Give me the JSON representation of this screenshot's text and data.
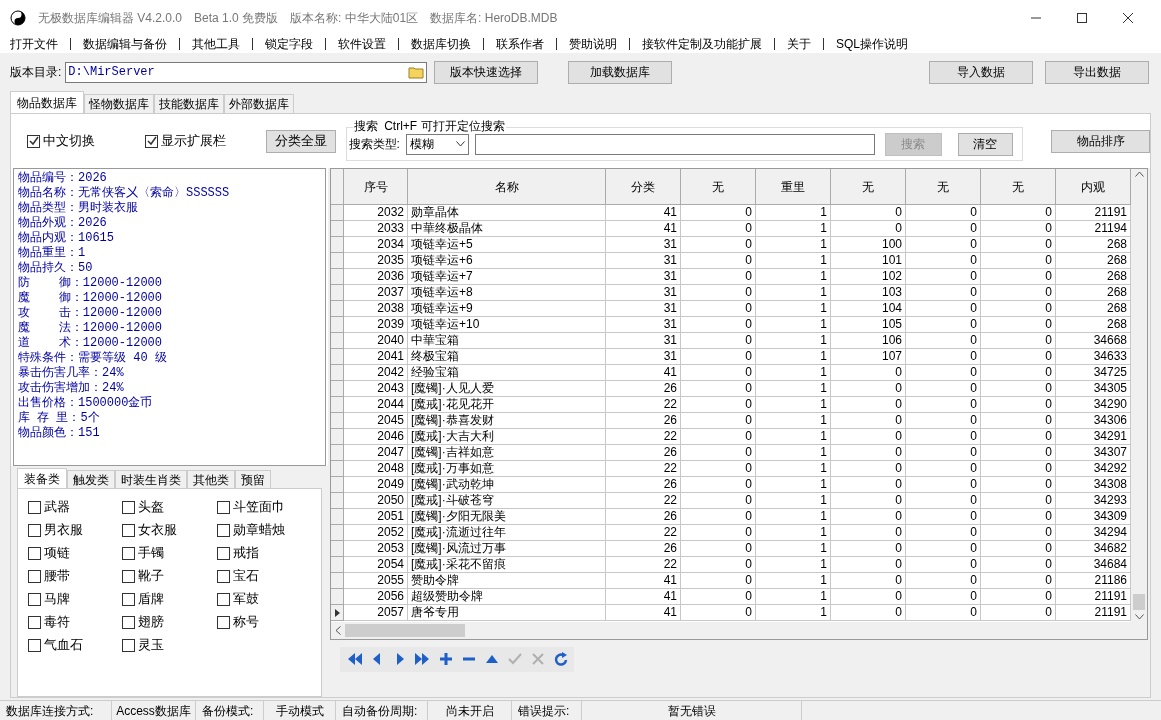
{
  "window": {
    "title": "无极数据库编辑器 V4.2.0.0",
    "edition": "Beta 1.0 免费版",
    "version_name": "版本名称: 中华大陆01区",
    "db_name": "数据库名: HeroDB.MDB"
  },
  "menu": [
    "打开文件",
    "数据编辑与备份",
    "其他工具",
    "锁定字段",
    "软件设置",
    "数据库切换",
    "联系作者",
    "赞助说明",
    "接软件定制及功能扩展",
    "关于",
    "SQL操作说明"
  ],
  "toolbar": {
    "dir_label": "版本目录:",
    "dir_value": "D:\\MirServer",
    "buttons": [
      "版本快速选择",
      "加载数据库"
    ],
    "right_buttons": [
      "导入数据",
      "导出数据"
    ]
  },
  "tabs": [
    {
      "label": "物品数据库",
      "selected": true
    },
    {
      "label": "怪物数据库",
      "selected": false
    },
    {
      "label": "技能数据库",
      "selected": false
    },
    {
      "label": "外部数据库",
      "selected": false
    }
  ],
  "options": [
    {
      "label": "中文切换",
      "checked": true
    },
    {
      "label": "显示扩展栏",
      "checked": true
    }
  ],
  "show_all_button": "分类全显",
  "search": {
    "legend": "搜索  Ctrl+F 可打开定位搜索",
    "type_label": "搜索类型:",
    "type_value": "模糊",
    "search_button": "搜索",
    "search_disabled": true,
    "clear_button": "清空"
  },
  "sort_button": "物品排序",
  "info": [
    "物品编号：2026",
    "物品名称：无常侠客㐅〈索命〉SSSSSS",
    "物品类型：男时装衣服",
    "物品外观：2026",
    "物品内观：10615",
    "物品重里：1",
    "物品持久：50",
    "防    御：12000-12000",
    "魔    御：12000-12000",
    "攻    击：12000-12000",
    "魔    法：12000-12000",
    "道    术：12000-12000",
    "特殊条件：需要等级 40 级",
    "暴击伤害几率：24%",
    "攻击伤害增加：24%",
    "出售价格：1500000金币",
    "库 存 里：5个",
    "物品颜色：151"
  ],
  "category_tabs": [
    {
      "label": "装备类",
      "selected": true
    },
    {
      "label": "触发类",
      "selected": false
    },
    {
      "label": "时装生肖类",
      "selected": false
    },
    {
      "label": "其他类",
      "selected": false
    },
    {
      "label": "预留",
      "selected": false
    }
  ],
  "categories": [
    {
      "label": "武器",
      "checked": false
    },
    {
      "label": "头盔",
      "checked": false
    },
    {
      "label": "斗笠面巾",
      "checked": false
    },
    {
      "label": "男衣服",
      "checked": false
    },
    {
      "label": "女衣服",
      "checked": false
    },
    {
      "label": "勋章蜡烛",
      "checked": false
    },
    {
      "label": "项链",
      "checked": false
    },
    {
      "label": "手镯",
      "checked": false
    },
    {
      "label": "戒指",
      "checked": false
    },
    {
      "label": "腰带",
      "checked": false
    },
    {
      "label": "靴子",
      "checked": false
    },
    {
      "label": "宝石",
      "checked": false
    },
    {
      "label": "马牌",
      "checked": false
    },
    {
      "label": "盾牌",
      "checked": false
    },
    {
      "label": "军鼓",
      "checked": false
    },
    {
      "label": "毒符",
      "checked": false
    },
    {
      "label": "翅膀",
      "checked": false
    },
    {
      "label": "称号",
      "checked": false
    },
    {
      "label": "气血石",
      "checked": false
    },
    {
      "label": "灵玉",
      "checked": false
    }
  ],
  "table": {
    "columns": [
      "序号",
      "名称",
      "分类",
      "无",
      "重里",
      "无",
      "无",
      "无",
      "内观"
    ],
    "rows": [
      {
        "cells": [
          "2032",
          "勋章晶体",
          "41",
          "0",
          "1",
          "0",
          "0",
          "0",
          "21191"
        ],
        "selected": false
      },
      {
        "cells": [
          "2033",
          "中華终极晶体",
          "41",
          "0",
          "1",
          "0",
          "0",
          "0",
          "21194"
        ],
        "selected": false
      },
      {
        "cells": [
          "2034",
          "项链幸运+5",
          "31",
          "0",
          "1",
          "100",
          "0",
          "0",
          "268"
        ],
        "selected": false
      },
      {
        "cells": [
          "2035",
          "项链幸运+6",
          "31",
          "0",
          "1",
          "101",
          "0",
          "0",
          "268"
        ],
        "selected": false
      },
      {
        "cells": [
          "2036",
          "项链幸运+7",
          "31",
          "0",
          "1",
          "102",
          "0",
          "0",
          "268"
        ],
        "selected": false
      },
      {
        "cells": [
          "2037",
          "项链幸运+8",
          "31",
          "0",
          "1",
          "103",
          "0",
          "0",
          "268"
        ],
        "selected": false
      },
      {
        "cells": [
          "2038",
          "项链幸运+9",
          "31",
          "0",
          "1",
          "104",
          "0",
          "0",
          "268"
        ],
        "selected": false
      },
      {
        "cells": [
          "2039",
          "项链幸运+10",
          "31",
          "0",
          "1",
          "105",
          "0",
          "0",
          "268"
        ],
        "selected": false
      },
      {
        "cells": [
          "2040",
          "中華宝箱",
          "31",
          "0",
          "1",
          "106",
          "0",
          "0",
          "34668"
        ],
        "selected": false
      },
      {
        "cells": [
          "2041",
          "终极宝箱",
          "31",
          "0",
          "1",
          "107",
          "0",
          "0",
          "34633"
        ],
        "selected": false
      },
      {
        "cells": [
          "2042",
          "经验宝箱",
          "41",
          "0",
          "1",
          "0",
          "0",
          "0",
          "34725"
        ],
        "selected": false
      },
      {
        "cells": [
          "2043",
          "[魔镯]·人见人爱",
          "26",
          "0",
          "1",
          "0",
          "0",
          "0",
          "34305"
        ],
        "selected": false
      },
      {
        "cells": [
          "2044",
          "[魔戒]·花见花开",
          "22",
          "0",
          "1",
          "0",
          "0",
          "0",
          "34290"
        ],
        "selected": false
      },
      {
        "cells": [
          "2045",
          "[魔镯]·恭喜发财",
          "26",
          "0",
          "1",
          "0",
          "0",
          "0",
          "34306"
        ],
        "selected": false
      },
      {
        "cells": [
          "2046",
          "[魔戒]·大吉大利",
          "22",
          "0",
          "1",
          "0",
          "0",
          "0",
          "34291"
        ],
        "selected": false
      },
      {
        "cells": [
          "2047",
          "[魔镯]·吉祥如意",
          "26",
          "0",
          "1",
          "0",
          "0",
          "0",
          "34307"
        ],
        "selected": false
      },
      {
        "cells": [
          "2048",
          "[魔戒]·万事如意",
          "22",
          "0",
          "1",
          "0",
          "0",
          "0",
          "34292"
        ],
        "selected": false
      },
      {
        "cells": [
          "2049",
          "[魔镯]·武动乾坤",
          "26",
          "0",
          "1",
          "0",
          "0",
          "0",
          "34308"
        ],
        "selected": false
      },
      {
        "cells": [
          "2050",
          "[魔戒]·斗破苍穹",
          "22",
          "0",
          "1",
          "0",
          "0",
          "0",
          "34293"
        ],
        "selected": false
      },
      {
        "cells": [
          "2051",
          "[魔镯]·夕阳无限美",
          "26",
          "0",
          "1",
          "0",
          "0",
          "0",
          "34309"
        ],
        "selected": false
      },
      {
        "cells": [
          "2052",
          "[魔戒]·流逝过往年",
          "22",
          "0",
          "1",
          "0",
          "0",
          "0",
          "34294"
        ],
        "selected": false
      },
      {
        "cells": [
          "2053",
          "[魔镯]·风流过万事",
          "26",
          "0",
          "1",
          "0",
          "0",
          "0",
          "34682"
        ],
        "selected": false
      },
      {
        "cells": [
          "2054",
          "[魔戒]·采花不留痕",
          "22",
          "0",
          "1",
          "0",
          "0",
          "0",
          "34684"
        ],
        "selected": false
      },
      {
        "cells": [
          "2055",
          "赞助令牌",
          "41",
          "0",
          "1",
          "0",
          "0",
          "0",
          "21186"
        ],
        "selected": false
      },
      {
        "cells": [
          "2056",
          "超级赞助令牌",
          "41",
          "0",
          "1",
          "0",
          "0",
          "0",
          "21191"
        ],
        "selected": false
      },
      {
        "cells": [
          "2057",
          "唐爷专用",
          "41",
          "0",
          "1",
          "0",
          "0",
          "0",
          "21191"
        ],
        "selected": true
      }
    ]
  },
  "navigator": [
    {
      "kind": "first",
      "disabled": false
    },
    {
      "kind": "prior",
      "disabled": false
    },
    {
      "kind": "next",
      "disabled": false
    },
    {
      "kind": "last",
      "disabled": false
    },
    {
      "kind": "insert",
      "disabled": false
    },
    {
      "kind": "delete",
      "disabled": false
    },
    {
      "kind": "edit",
      "disabled": false
    },
    {
      "kind": "post",
      "disabled": true
    },
    {
      "kind": "cancel",
      "disabled": true
    },
    {
      "kind": "refresh",
      "disabled": false
    }
  ],
  "status_bar": [
    "数据库连接方式:",
    "Access数据库",
    "备份模式:",
    "手动模式",
    "自动备份周期:",
    "尚未开启",
    "错误提示:",
    "暂无错误"
  ]
}
